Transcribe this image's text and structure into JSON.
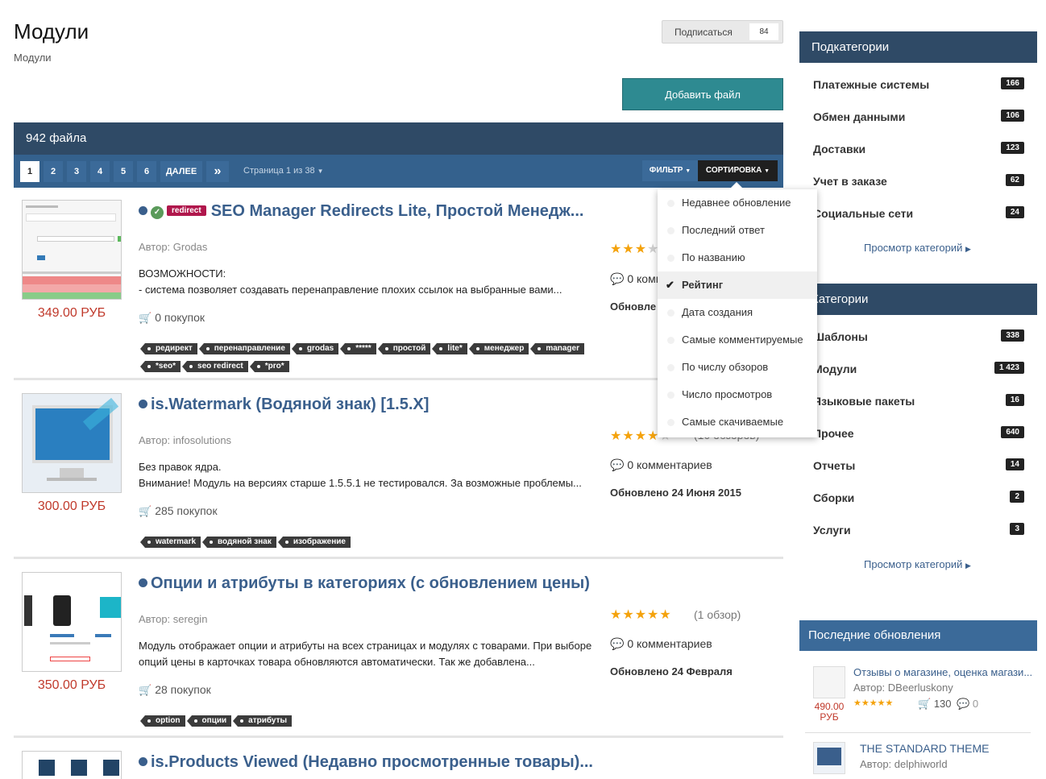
{
  "page": {
    "title": "Модули",
    "breadcrumb": "Модули",
    "subscribe_label": "Подписаться",
    "subscribe_count": "84",
    "add_file_label": "Добавить файл"
  },
  "list_header": {
    "count_label": "942 файла",
    "pages": [
      "1",
      "2",
      "3",
      "4",
      "5",
      "6"
    ],
    "next_label": "ДАЛЕЕ",
    "last_label": "»",
    "page_info": "Страница 1 из 38",
    "filter_label": "ФИЛЬТР",
    "sort_label": "СОРТИРОВКА"
  },
  "sort_menu": {
    "items": [
      "Недавнее обновление",
      "Последний ответ",
      "По названию",
      "Рейтинг",
      "Дата создания",
      "Самые комментируемые",
      "По числу обзоров",
      "Число просмотров",
      "Самые скачиваемые"
    ],
    "selected": "Рейтинг"
  },
  "files": [
    {
      "title": "SEO Manager Redirects Lite, Простой Менедж...",
      "badge": "redirect",
      "author": "Автор: Grodas",
      "desc1": "ВОЗМОЖНОСТИ:",
      "desc2": "- система позволяет создавать перенаправление плохих ссылок на выбранные вами...",
      "price": "349.00 РУБ",
      "purchases": "0 покупок",
      "rating": 3,
      "reviews": "",
      "comments": "0 комм",
      "updated": "Обновле",
      "tags": [
        "редирект",
        "перенаправление",
        "grodas",
        "*****",
        "простой",
        "lite*",
        "менеджер",
        "manager",
        "*seo*",
        "seo redirect",
        "*pro*"
      ]
    },
    {
      "title": "is.Watermark (Водяной знак) [1.5.X]",
      "author": "Автор: infosolutions",
      "desc1": "Без правок ядра.",
      "desc2": "Внимание! Модуль на версиях старше 1.5.5.1 не тестировался. За возможные проблемы...",
      "price": "300.00 РУБ",
      "purchases": "285 покупок",
      "rating": 4,
      "reviews": "(10 обзоров)",
      "comments": "0 комментариев",
      "updated": "Обновлено 24 Июня 2015",
      "tags": [
        "watermark",
        "водяной знак",
        "изображение"
      ]
    },
    {
      "title": "Опции и атрибуты в категориях (с обновлением цены)",
      "author": "Автор: seregin",
      "desc1": "Модуль отображает опции и атрибуты на всех страницах и модулях с товарами. При выборе",
      "desc2": "опций цены в карточках товара обновляются автоматически. Так же добавлена...",
      "price": "350.00 РУБ",
      "purchases": "28 покупок",
      "rating": 5,
      "reviews": "(1 обзор)",
      "comments": "0 комментариев",
      "updated": "Обновлено 24 Февраля",
      "tags": [
        "option",
        "опции",
        "атрибуты"
      ]
    },
    {
      "title": "is.Products Viewed (Недавно просмотренные товары)..."
    }
  ],
  "sidebar": {
    "subcategories": {
      "title": "Подкатегории",
      "items": [
        {
          "name": "Платежные системы",
          "count": "166"
        },
        {
          "name": "Обмен данными",
          "count": "106"
        },
        {
          "name": "Доставки",
          "count": "123"
        },
        {
          "name": "Учет в заказе",
          "count": "62"
        },
        {
          "name": "Социальные сети",
          "count": "24"
        }
      ],
      "more_label": "Просмотр категорий"
    },
    "categories": {
      "title": "Категории",
      "items": [
        {
          "name": "Шаблоны",
          "count": "338"
        },
        {
          "name": "Модули",
          "count": "1 423"
        },
        {
          "name": "Языковые пакеты",
          "count": "16"
        },
        {
          "name": "Прочее",
          "count": "640"
        },
        {
          "name": "Отчеты",
          "count": "14"
        },
        {
          "name": "Сборки",
          "count": "2"
        },
        {
          "name": "Услуги",
          "count": "3"
        }
      ],
      "more_label": "Просмотр категорий"
    },
    "updates": {
      "title": "Последние обновления",
      "items": [
        {
          "title": "Отзывы о магазине, оценка магази...",
          "author": "Автор: DBeerluskony",
          "price": "490.00",
          "currency": "РУБ",
          "purchases": "130",
          "comments": "0"
        },
        {
          "title": "THE STANDARD THEME",
          "author": "Автор: delphiworld"
        }
      ]
    }
  },
  "colors": {
    "header_bg": "#2f4a66",
    "pagination_bg": "#3b6a99",
    "add_button": "#2e8a91",
    "price": "#c0392b",
    "star": "#f4a20c",
    "badge": "#b0174c"
  }
}
